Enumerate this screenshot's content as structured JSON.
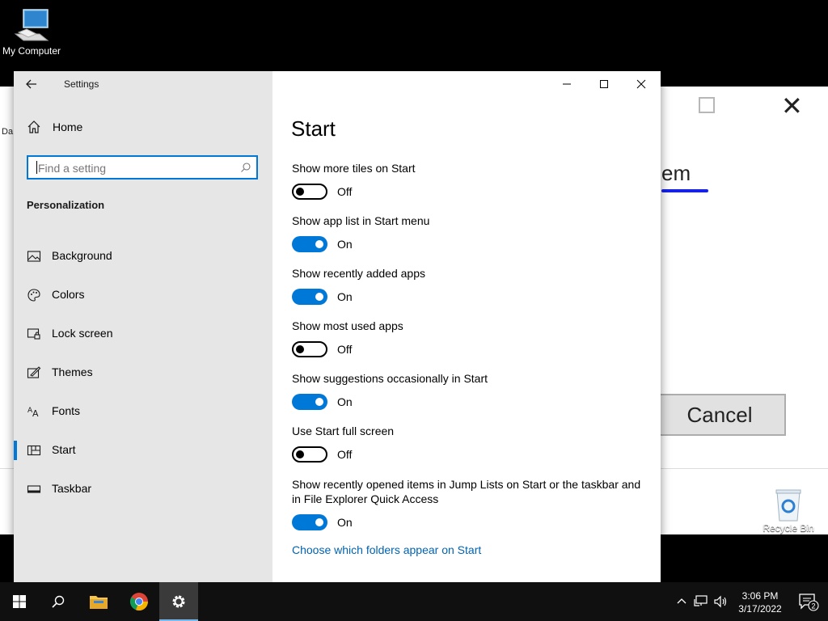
{
  "desktop": {
    "icons": [
      {
        "label": "My Computer"
      },
      {
        "label": "Recycle Bin"
      }
    ],
    "background_dialog": {
      "partial_word": "em",
      "cancel_label": "Cancel",
      "cut_text": "Da"
    }
  },
  "window": {
    "title": "Settings",
    "controls": [
      "minimize",
      "maximize",
      "close"
    ]
  },
  "sidebar": {
    "home_label": "Home",
    "search_placeholder": "Find a setting",
    "section_title": "Personalization",
    "items": [
      {
        "label": "Background",
        "icon": "image-icon",
        "active": false
      },
      {
        "label": "Colors",
        "icon": "palette-icon",
        "active": false
      },
      {
        "label": "Lock screen",
        "icon": "lock-screen-icon",
        "active": false
      },
      {
        "label": "Themes",
        "icon": "themes-icon",
        "active": false
      },
      {
        "label": "Fonts",
        "icon": "fonts-icon",
        "active": false
      },
      {
        "label": "Start",
        "icon": "start-icon",
        "active": true
      },
      {
        "label": "Taskbar",
        "icon": "taskbar-icon",
        "active": false
      }
    ]
  },
  "main": {
    "title": "Start",
    "settings": [
      {
        "label": "Show more tiles on Start",
        "state": "Off"
      },
      {
        "label": "Show app list in Start menu",
        "state": "On"
      },
      {
        "label": "Show recently added apps",
        "state": "On"
      },
      {
        "label": "Show most used apps",
        "state": "Off"
      },
      {
        "label": "Show suggestions occasionally in Start",
        "state": "On"
      },
      {
        "label": "Use Start full screen",
        "state": "Off"
      },
      {
        "label": "Show recently opened items in Jump Lists on Start or the taskbar and in File Explorer Quick Access",
        "state": "On"
      }
    ],
    "link": "Choose which folders appear on Start"
  },
  "taskbar": {
    "buttons": [
      "windows-start-icon",
      "search-icon",
      "file-explorer-icon",
      "chrome-icon",
      "settings-gear-icon"
    ],
    "time": "3:06 PM",
    "date": "3/17/2022",
    "notification_count": "2"
  },
  "colors": {
    "accent": "#0078d7",
    "link": "#0063b1",
    "sidebar_bg": "#e6e6e6"
  }
}
